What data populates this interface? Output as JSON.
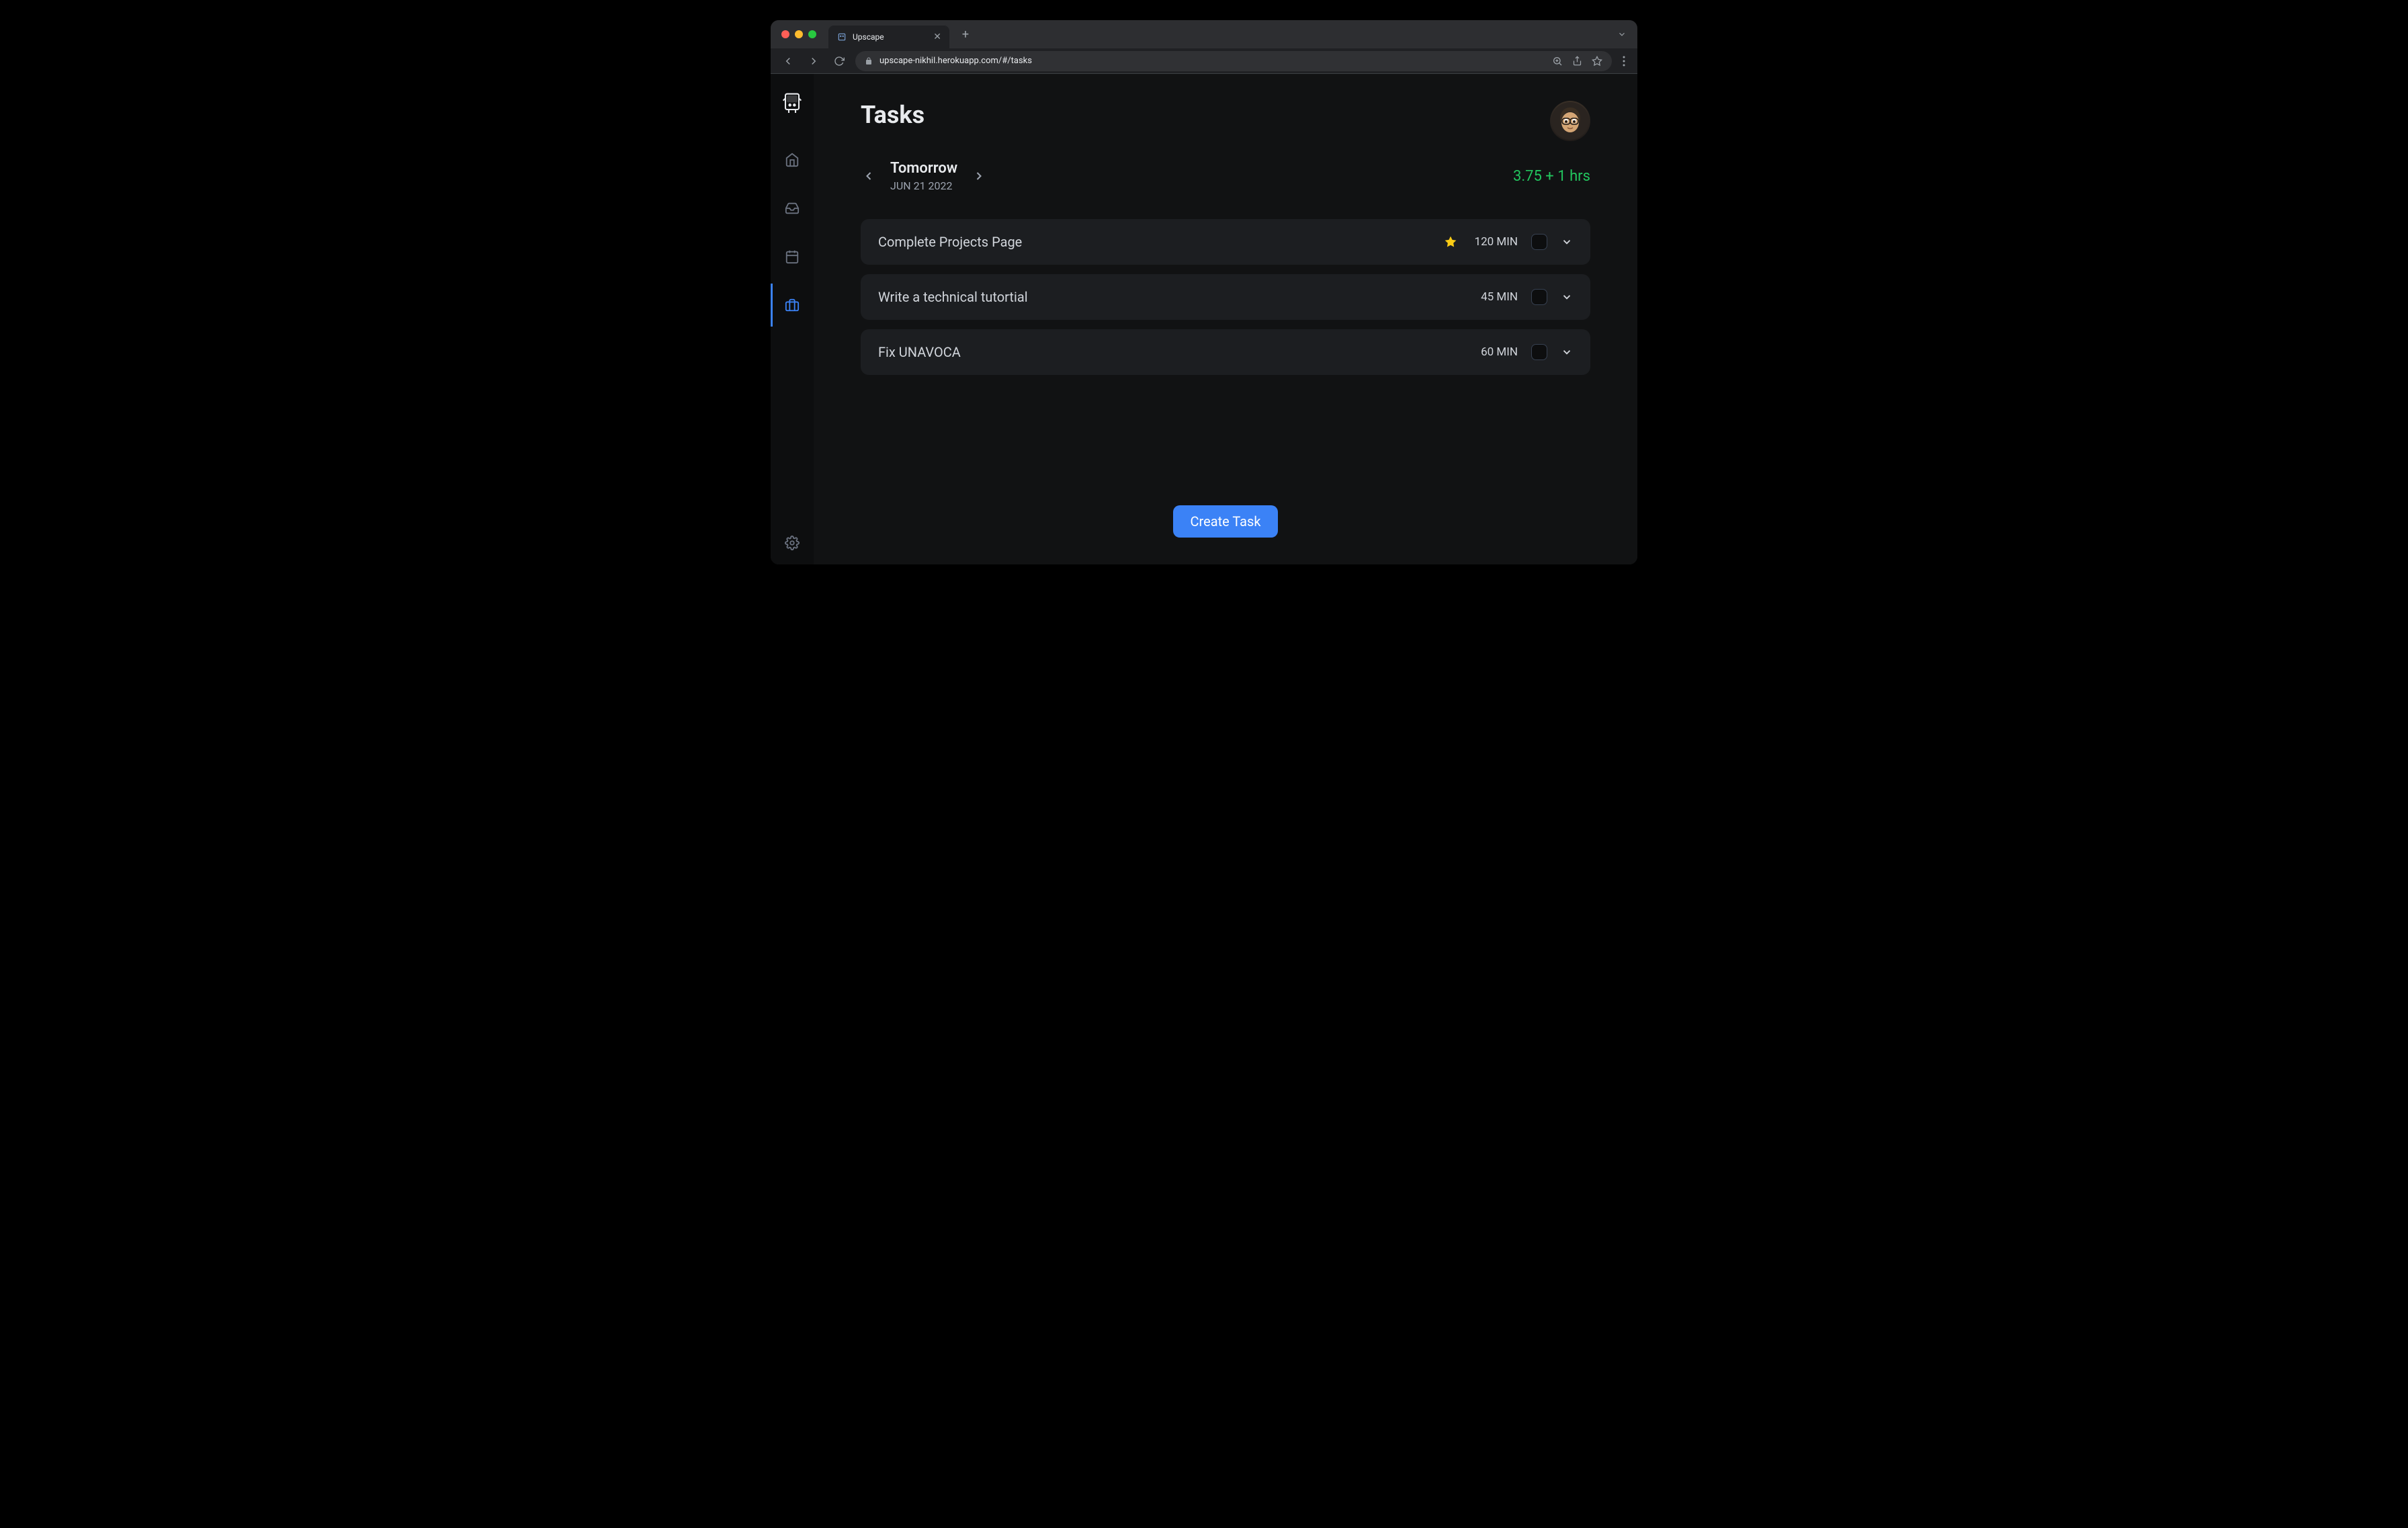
{
  "browser": {
    "tab_title": "Upscape",
    "url": "upscape-nikhil.herokuapp.com/#/tasks"
  },
  "page": {
    "title": "Tasks"
  },
  "date_nav": {
    "label": "Tomorrow",
    "date": "JUN 21 2022"
  },
  "summary": {
    "hours": "3.75 + 1 hrs"
  },
  "tasks": [
    {
      "title": "Complete Projects Page",
      "duration": "120 MIN",
      "starred": true
    },
    {
      "title": "Write a technical tutortial",
      "duration": "45 MIN",
      "starred": false
    },
    {
      "title": "Fix UNAVOCA",
      "duration": "60 MIN",
      "starred": false
    }
  ],
  "actions": {
    "create_task": "Create Task"
  }
}
